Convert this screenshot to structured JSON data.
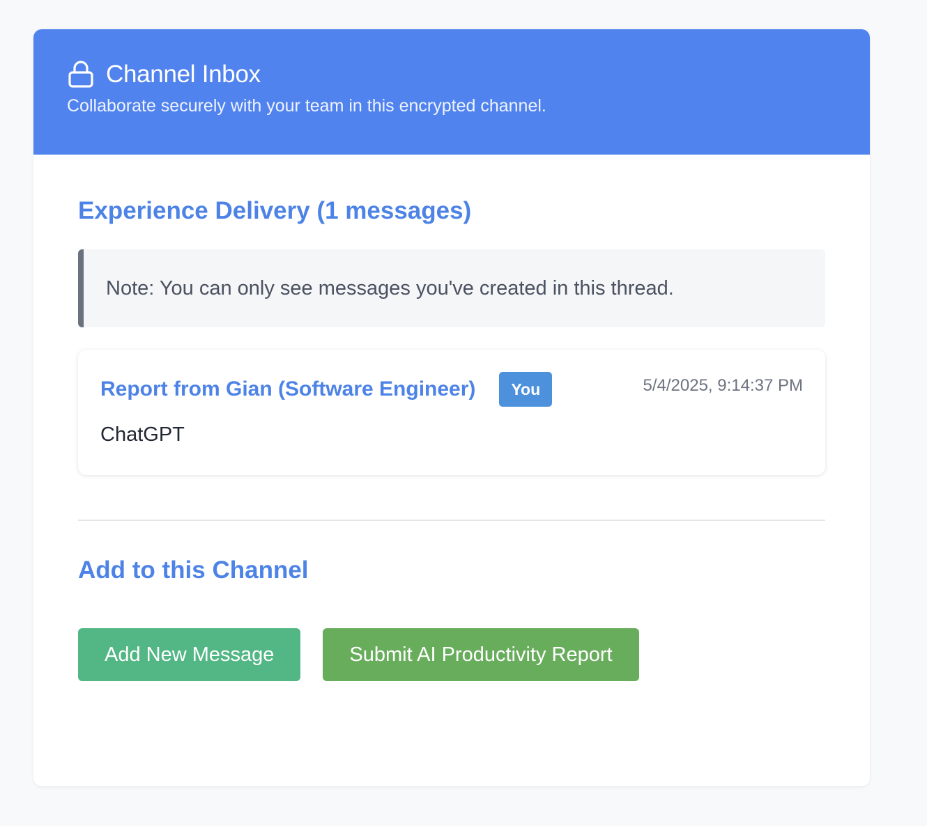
{
  "header": {
    "title": "Channel Inbox",
    "subtitle": "Collaborate securely with your team in this encrypted channel.",
    "icon": "lock-icon",
    "color": "#5183ee"
  },
  "thread": {
    "heading": "Experience Delivery (1 messages)",
    "note": "Note: You can only see messages you've created in this thread.",
    "messages": [
      {
        "author": "Report from Gian (Software Engineer)",
        "badge": "You",
        "timestamp": "5/4/2025, 9:14:37 PM",
        "body": "ChatGPT"
      }
    ]
  },
  "add_section": {
    "heading": "Add to this Channel",
    "add_message_label": "Add New Message",
    "submit_report_label": "Submit AI Productivity Report"
  },
  "colors": {
    "accent": "#4d83e6",
    "badge": "#4d91dd",
    "add_button": "#52b685",
    "submit_button": "#68ad5c"
  }
}
